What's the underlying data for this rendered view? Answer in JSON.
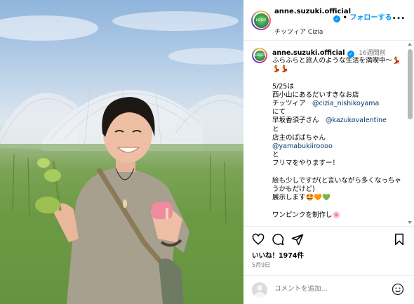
{
  "post": {
    "username": "anne.suzuki.official",
    "follow_label": "フォローする",
    "follow_dot": "•",
    "location": "チッツィア Cizia",
    "more_label": "...",
    "avatar_text": "LOGO"
  },
  "caption": {
    "username": "anne.suzuki.official",
    "time": "16週間前",
    "lines": [
      {
        "text": "ふらふらと旅人のような生活を満喫中〜💃💃💃"
      },
      {
        "text": ""
      },
      {
        "text": "5/25は"
      },
      {
        "text": "西小山にあるだいすきなお店"
      },
      {
        "text": "チッツィア　",
        "mention": "@cizia_nishikoyama"
      },
      {
        "text": "にて"
      },
      {
        "text": "早坂香須子さん　",
        "mention": "@kazukovalentine"
      },
      {
        "text": "と"
      },
      {
        "text": "店主のばばちゃん"
      },
      {
        "text": "",
        "mention": "@yamabukiiroooo"
      },
      {
        "text": "と"
      },
      {
        "text": "フリマをやりますー！"
      },
      {
        "text": ""
      },
      {
        "text": "絵も少しですが(と言いながら多くなっちゃうかもだけど)"
      },
      {
        "text": "展示します🤩🧡💚"
      },
      {
        "text": ""
      },
      {
        "text": "ワンピンクを制作し🌸"
      }
    ]
  },
  "actions": {
    "likes": "いいね！1974件",
    "date": "5月9日"
  },
  "comment": {
    "placeholder": "コメントを追加..."
  },
  "icons": [
    "heart-icon",
    "comment-icon",
    "share-icon",
    "bookmark-icon",
    "emoji-icon",
    "verified-icon",
    "more-icon"
  ]
}
